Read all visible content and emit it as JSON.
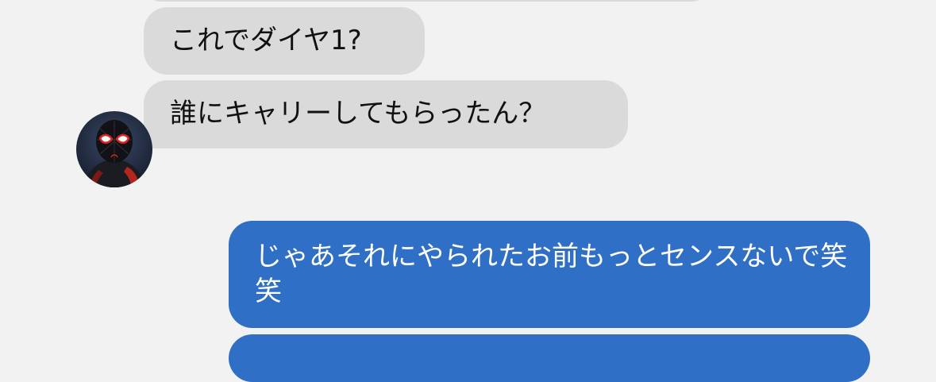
{
  "chat": {
    "messages": [
      {
        "direction": "incoming",
        "text": ""
      },
      {
        "direction": "incoming",
        "text": "これでダイヤ1?"
      },
      {
        "direction": "incoming",
        "text": "誰にキャリーしてもらったん？"
      },
      {
        "direction": "outgoing",
        "text": "じゃあそれにやられたお前もっとセンスないで笑笑"
      },
      {
        "direction": "outgoing",
        "text": ""
      }
    ],
    "contact": {
      "avatar_icon": "spider-hero-avatar-icon"
    }
  },
  "colors": {
    "background": "#f2f2f2",
    "incoming_bubble": "#dadada",
    "outgoing_bubble": "#2f6fc6",
    "incoming_text": "#111111",
    "outgoing_text": "#ffffff"
  }
}
